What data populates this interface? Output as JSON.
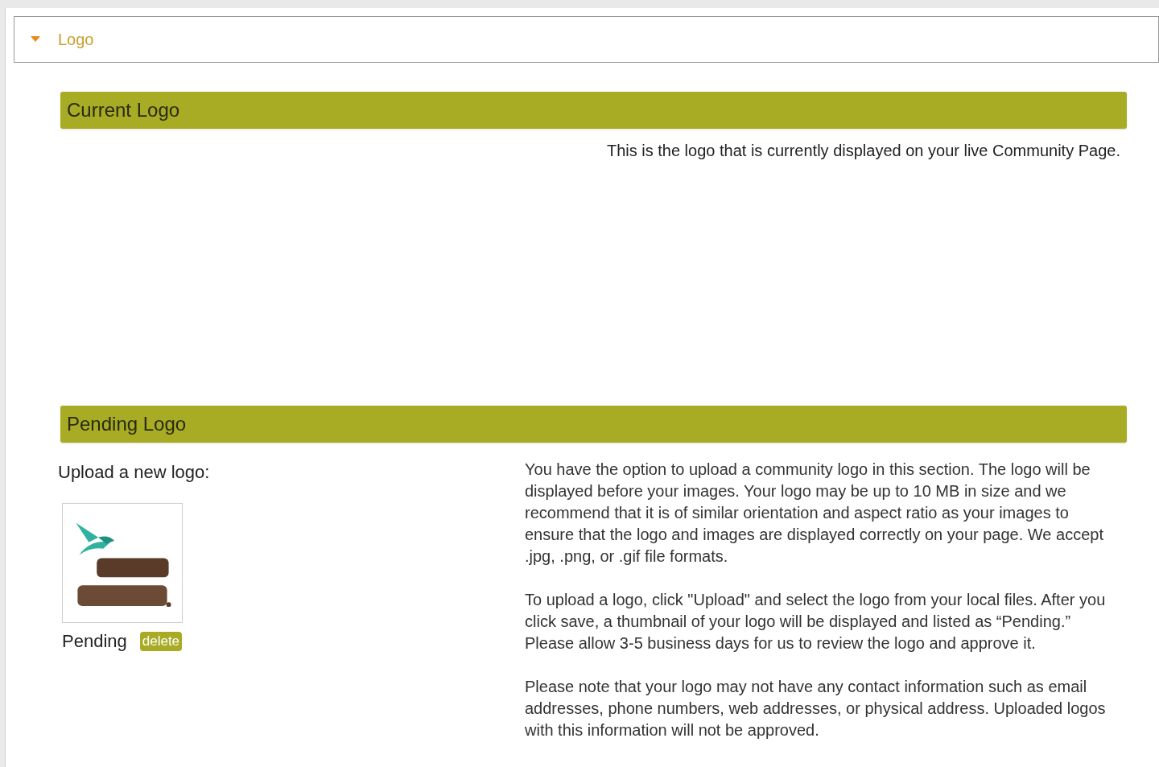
{
  "section": {
    "title": "Logo",
    "expanded": true
  },
  "current": {
    "heading": "Current Logo",
    "description": "This is the logo that is currently displayed on your live Community Page."
  },
  "pending": {
    "heading": "Pending Logo",
    "upload_label": "Upload a new logo:",
    "status": "Pending",
    "delete_button": "delete",
    "paragraphs": [
      "You have the option to upload a community logo in this section. The logo will be displayed before your images. Your logo may be up to 10 MB in size and we recommend that it is of similar orientation and aspect ratio as your images to ensure that the logo and images are displayed correctly on your page. We accept .jpg, .png, or .gif file formats.",
      "To upload a logo, click \"Upload\" and select the logo from your local files. After you click save, a thumbnail of your logo will be displayed and listed as “Pending.” Please allow 3-5 business days for us to review the logo and approve it.",
      "Please note that your logo may not have any contact information such as email addresses, phone numbers, web addresses, or physical address. Uploaded logos with this information will not be approved."
    ]
  }
}
